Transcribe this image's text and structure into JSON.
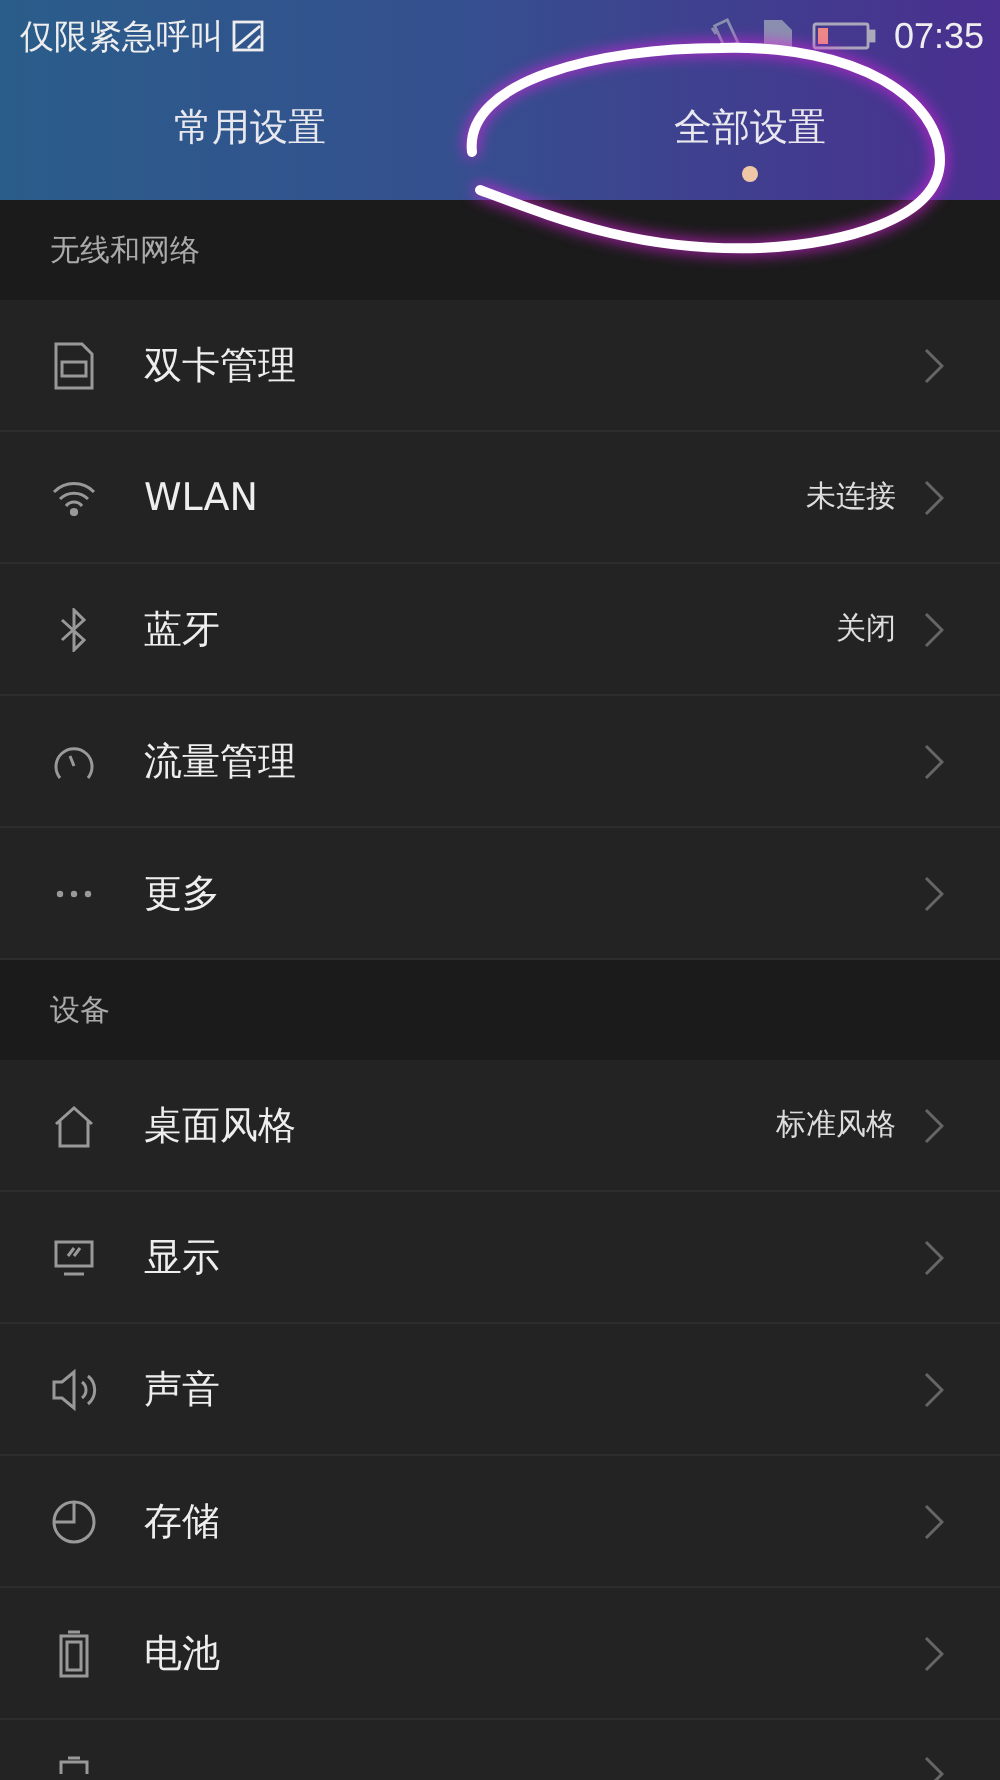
{
  "status_bar": {
    "carrier": "仅限紧急呼叫",
    "time": "07:35"
  },
  "tabs": [
    {
      "label": "常用设置",
      "selected": false
    },
    {
      "label": "全部设置",
      "selected": true
    }
  ],
  "sections": [
    {
      "title": "无线和网络",
      "rows": [
        {
          "label": "双卡管理"
        },
        {
          "label": "WLAN",
          "value": "未连接"
        },
        {
          "label": "蓝牙",
          "value": "关闭"
        },
        {
          "label": "流量管理"
        },
        {
          "label": "更多"
        }
      ]
    },
    {
      "title": "设备",
      "rows": [
        {
          "label": "桌面风格",
          "value": "标准风格"
        },
        {
          "label": "显示"
        },
        {
          "label": "声音"
        },
        {
          "label": "存储"
        },
        {
          "label": "电池"
        }
      ]
    }
  ]
}
